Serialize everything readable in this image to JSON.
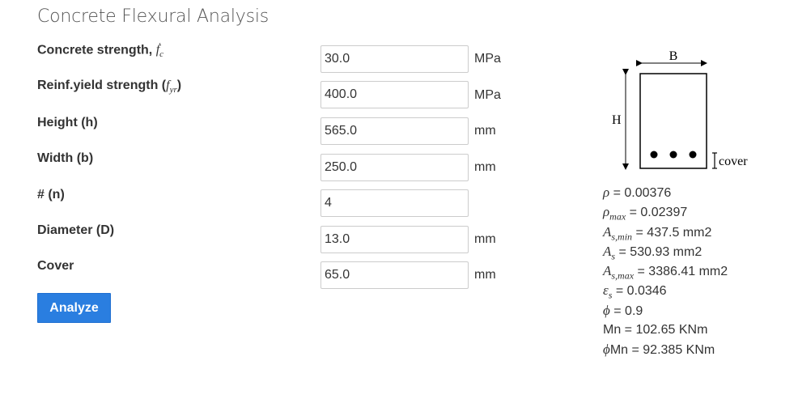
{
  "page": {
    "title": "Concrete Flexural Analysis"
  },
  "form": {
    "fc": {
      "label": "Concrete strength, ",
      "value": "30.0",
      "unit": "MPa"
    },
    "fyr": {
      "label": "Reinf.yield strength (",
      "label_end": ")",
      "value": "400.0",
      "unit": "MPa"
    },
    "height": {
      "label": "Height (h)",
      "value": "565.0",
      "unit": "mm"
    },
    "width": {
      "label": "Width (b)",
      "value": "250.0",
      "unit": "mm"
    },
    "count": {
      "label": "# (n)",
      "value": "4",
      "unit": ""
    },
    "diameter": {
      "label": "Diameter (D)",
      "value": "13.0",
      "unit": "mm"
    },
    "cover": {
      "label": "Cover",
      "value": "65.0",
      "unit": "mm"
    },
    "analyze_label": "Analyze"
  },
  "diagram": {
    "width_label": "B",
    "height_label": "H",
    "cover_label": "cover",
    "bar_count": 3
  },
  "results": {
    "rho": " = 0.00376",
    "rho_max": " = 0.02397",
    "as_min": " = 437.5 mm2",
    "as": " = 530.93 mm2",
    "as_max": " = 3386.41 mm2",
    "eps_s": " = 0.0346",
    "phi": " = 0.9",
    "mn": "Mn = 102.65 KNm",
    "phi_mn": "Mn = 92.385 KNm"
  },
  "colors": {
    "button": "#2a7ee0",
    "text": "#333333",
    "input_border": "#cccccc"
  }
}
